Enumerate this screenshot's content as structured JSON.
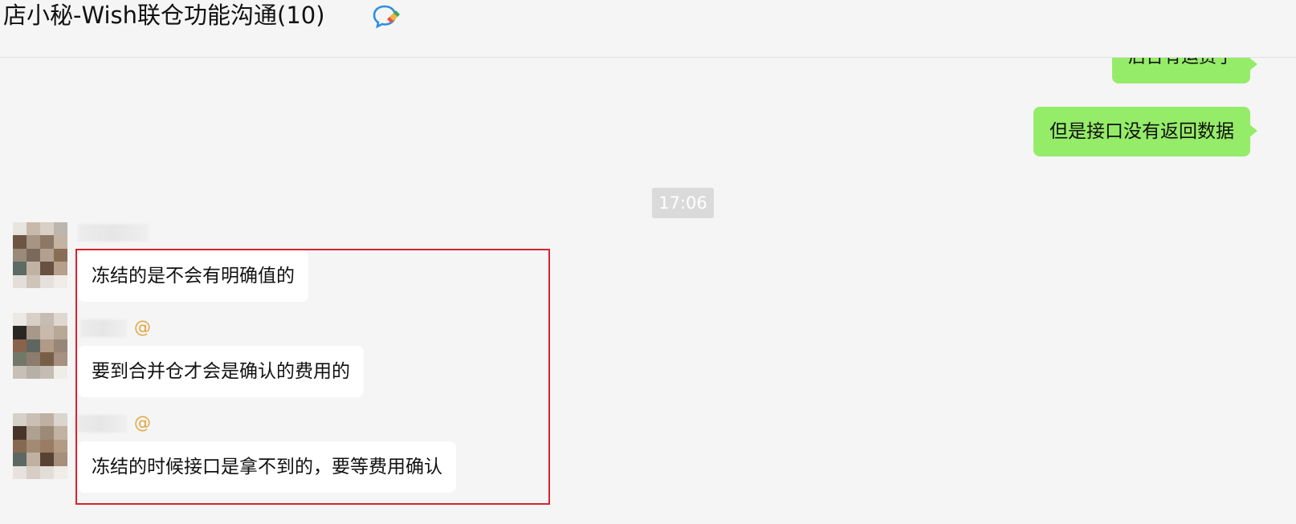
{
  "chat": {
    "title": "店小秘-Wish联仓功能沟通(10)",
    "title_icon": "chat-bubbles-icon"
  },
  "messages": [
    {
      "direction": "outgoing",
      "text": "后台有运费了",
      "clipped": true
    },
    {
      "direction": "outgoing",
      "text": "但是接口没有返回数据"
    }
  ],
  "timestamp": "17:06",
  "incoming": [
    {
      "sender": "redacted",
      "mention": "",
      "text": "冻结的是不会有明确值的"
    },
    {
      "sender": "redacted",
      "mention": "@",
      "text": "要到合并仓才会是确认的费用的"
    },
    {
      "sender": "redacted",
      "mention": "@",
      "text": "冻结的时候接口是拿不到的，要等费用确认"
    }
  ],
  "colors": {
    "outgoing_bubble": "#95ec69",
    "incoming_bubble": "#ffffff",
    "highlight_border": "#d9232d",
    "mention": "#e2a53c",
    "background": "#f5f5f5"
  }
}
